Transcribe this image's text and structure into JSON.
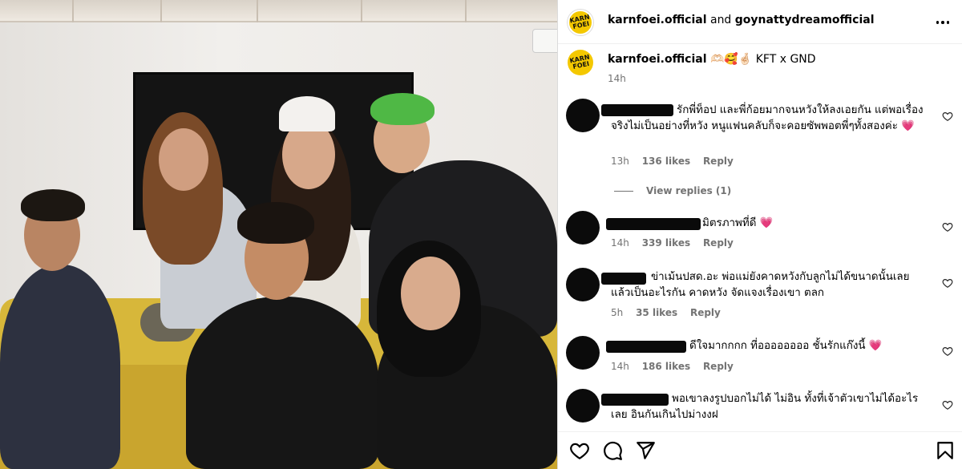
{
  "header": {
    "author": "karnfoei.official",
    "joiner": "and",
    "coauthor": "goynattydreamofficial",
    "avatar_logo": "KARN FOEI"
  },
  "caption": {
    "author": "karnfoei.official",
    "text": "🫶🏻🥰🤞🏻 KFT x GND",
    "time": "14h"
  },
  "comments": [
    {
      "text": "รักพี่ท็อป และพี่ก้อยมากจนหวังให้ลงเอยกัน แต่พอเรื่องจริงไม่เป็นอย่างที่หวัง หนูแฟนคลับก็จะคอยซัพพอตพี่ๆทั้งสองค่ะ 💗",
      "time": "13h",
      "likes": "136 likes",
      "reply": "Reply"
    },
    {
      "text": "มิตรภาพที่ดี 💗",
      "time": "14h",
      "likes": "339 likes",
      "reply": "Reply"
    },
    {
      "text": "ข่าเม้นปสด.อะ พ่อแม่ยังคาดหวังกับลูกไม่ได้ขนาดนั้นเลย แล้วเป็นอะไรกัน คาดหวัง จัดแจงเรื่องเขา ตลก",
      "time": "5h",
      "likes": "35 likes",
      "reply": "Reply"
    },
    {
      "text": "ดีใจมากกกก ที่ออออออออ ชั้นรักแก๊งนี้ 💗",
      "time": "14h",
      "likes": "186 likes",
      "reply": "Reply"
    },
    {
      "text": "พอเขาลงรูปบอกไม่ได้ ไม่อิน ทั้งที่เจ้าตัวเขาไม่ได้อะไร เลย อินกันเกินไปม่างงฝ",
      "time": "",
      "likes": "",
      "reply": ""
    }
  ],
  "view_replies": "View replies (1)",
  "icons": {
    "like": "heart-icon",
    "comment": "comment-icon",
    "share": "share-icon",
    "save": "bookmark-icon",
    "more": "more-icon"
  }
}
